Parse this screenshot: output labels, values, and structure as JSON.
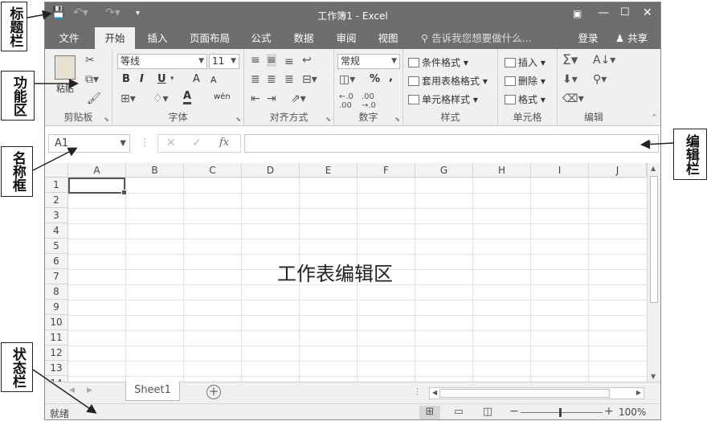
{
  "annotations": {
    "title_bar": "标题栏",
    "ribbon": "功能区",
    "name_box": "名称框",
    "formula_bar": "编辑栏",
    "status_bar": "状态栏",
    "worksheet_area": "工作表编辑区"
  },
  "titlebar": {
    "title": "工作簿1 - Excel",
    "save_icon": "save-icon",
    "undo_icon": "undo-icon",
    "redo_icon": "redo-icon"
  },
  "tabs": [
    "文件",
    "开始",
    "插入",
    "页面布局",
    "公式",
    "数据",
    "审阅",
    "视图"
  ],
  "active_tab": "开始",
  "search_placeholder": "告诉我您想要做什么...",
  "login": "登录",
  "share": "共享",
  "ribbon": {
    "clipboard": {
      "label": "剪贴板",
      "paste": "粘贴"
    },
    "font": {
      "label": "字体",
      "font_name": "等线",
      "font_size": "11",
      "bold": "B",
      "italic": "I",
      "underline": "U",
      "grow": "A",
      "shrink": "A",
      "color": "A",
      "phonetic": "wén"
    },
    "alignment": {
      "label": "对齐方式"
    },
    "number": {
      "label": "数字",
      "format": "常规",
      "percent": "%",
      "comma": ","
    },
    "styles": {
      "label": "样式",
      "conditional": "条件格式",
      "table": "套用表格格式",
      "cell": "单元格样式"
    },
    "cells": {
      "label": "单元格",
      "insert": "插入",
      "delete": "删除",
      "format": "格式"
    },
    "editing": {
      "label": "编辑"
    }
  },
  "name_box": "A1",
  "columns": [
    "A",
    "B",
    "C",
    "D",
    "E",
    "F",
    "G",
    "H",
    "I",
    "J"
  ],
  "rows": [
    "1",
    "2",
    "3",
    "4",
    "5",
    "6",
    "7",
    "8",
    "9",
    "10",
    "11",
    "12",
    "13",
    "14"
  ],
  "sheet_tab": "Sheet1",
  "status": {
    "ready": "就绪",
    "zoom": "100%",
    "minus": "−",
    "plus": "+"
  }
}
